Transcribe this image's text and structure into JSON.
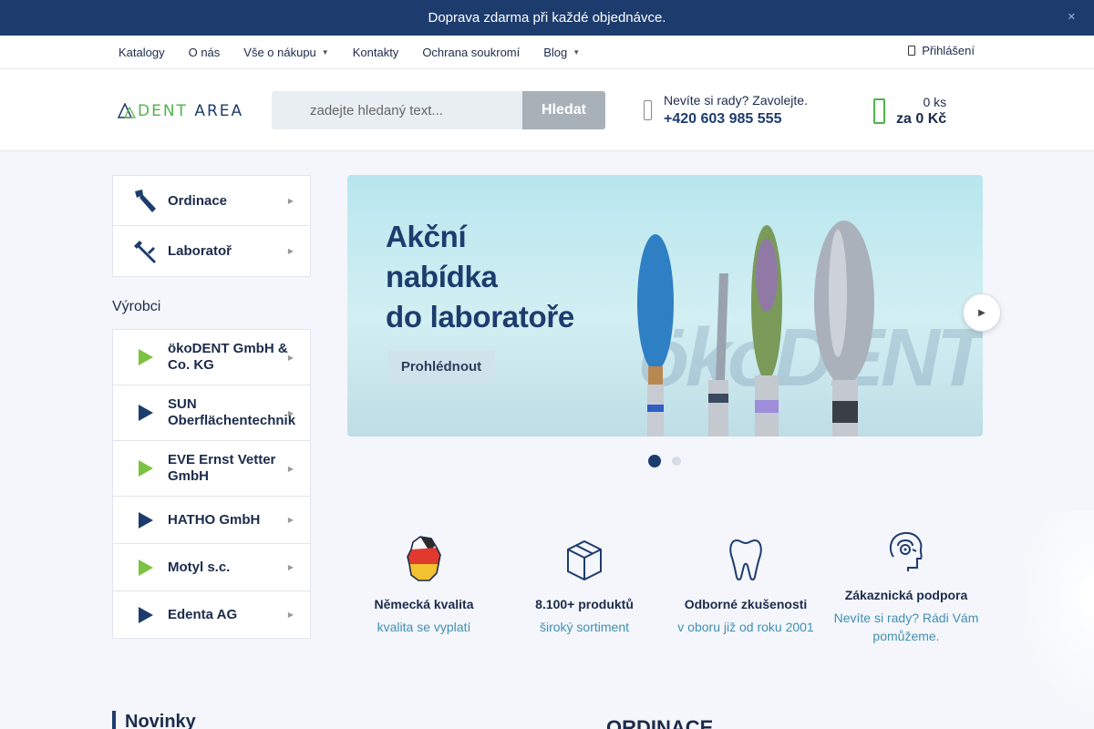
{
  "topbar": {
    "message": "Doprava zdarma při každé objednávce.",
    "close_icon": "close-icon"
  },
  "nav": {
    "items": [
      {
        "label": "Katalogy",
        "dropdown": false
      },
      {
        "label": "O nás",
        "dropdown": false
      },
      {
        "label": "Vše o nákupu",
        "dropdown": true
      },
      {
        "label": "Kontakty",
        "dropdown": false
      },
      {
        "label": "Ochrana soukromí",
        "dropdown": false
      },
      {
        "label": "Blog",
        "dropdown": true
      }
    ],
    "login": "Přihlášení"
  },
  "header": {
    "logo": {
      "part1": "DENT",
      "part2": "AREA"
    },
    "search": {
      "placeholder": "zadejte hledaný text...",
      "button": "Hledat"
    },
    "phone": {
      "prompt": "Nevíte si rady? Zavolejte.",
      "number": "+420 603 985 555"
    },
    "cart": {
      "qty": "0 ks",
      "total": "za 0 Kč"
    }
  },
  "categories": [
    {
      "label": "Ordinace",
      "icon": "dental-handpiece-icon"
    },
    {
      "label": "Laboratoř",
      "icon": "lab-tool-icon"
    }
  ],
  "manufacturers": {
    "title": "Výrobci",
    "items": [
      {
        "label": "ökoDENT GmbH & Co. KG",
        "color": "#7cc242"
      },
      {
        "label": "SUN Oberflächentechnik",
        "color": "#1d3c6e"
      },
      {
        "label": "EVE Ernst Vetter GmbH",
        "color": "#7cc242"
      },
      {
        "label": "HATHO GmbH",
        "color": "#1d3c6e"
      },
      {
        "label": "Motyl s.c.",
        "color": "#7cc242"
      },
      {
        "label": "Edenta AG",
        "color": "#1d3c6e"
      }
    ]
  },
  "banner": {
    "line1": "Akční",
    "line2": "nabídka",
    "line3": "do laboratoře",
    "cta": "Prohlédnout",
    "watermark": "ökoDENT",
    "slides_total": 2,
    "active_slide": 1
  },
  "features": [
    {
      "title": "Německá kvalita",
      "subtitle": "kvalita se vyplatí",
      "icon": "germany-map-icon"
    },
    {
      "title": "8.100+ produktů",
      "subtitle": "široký sortiment",
      "icon": "box-icon"
    },
    {
      "title": "Odborné zkušenosti",
      "subtitle": "v oboru již od roku 2001",
      "icon": "tooth-icon"
    },
    {
      "title": "Zákaznická podpora",
      "subtitle": "Nevíte si rady? Rádi Vám pomůžeme.",
      "icon": "support-headset-icon"
    }
  ],
  "sections": {
    "left": "Novinky",
    "right": "ORDINACE"
  },
  "colors": {
    "primary": "#1d3c6e",
    "accent": "#4fb34a",
    "link": "#3f8fb3"
  }
}
